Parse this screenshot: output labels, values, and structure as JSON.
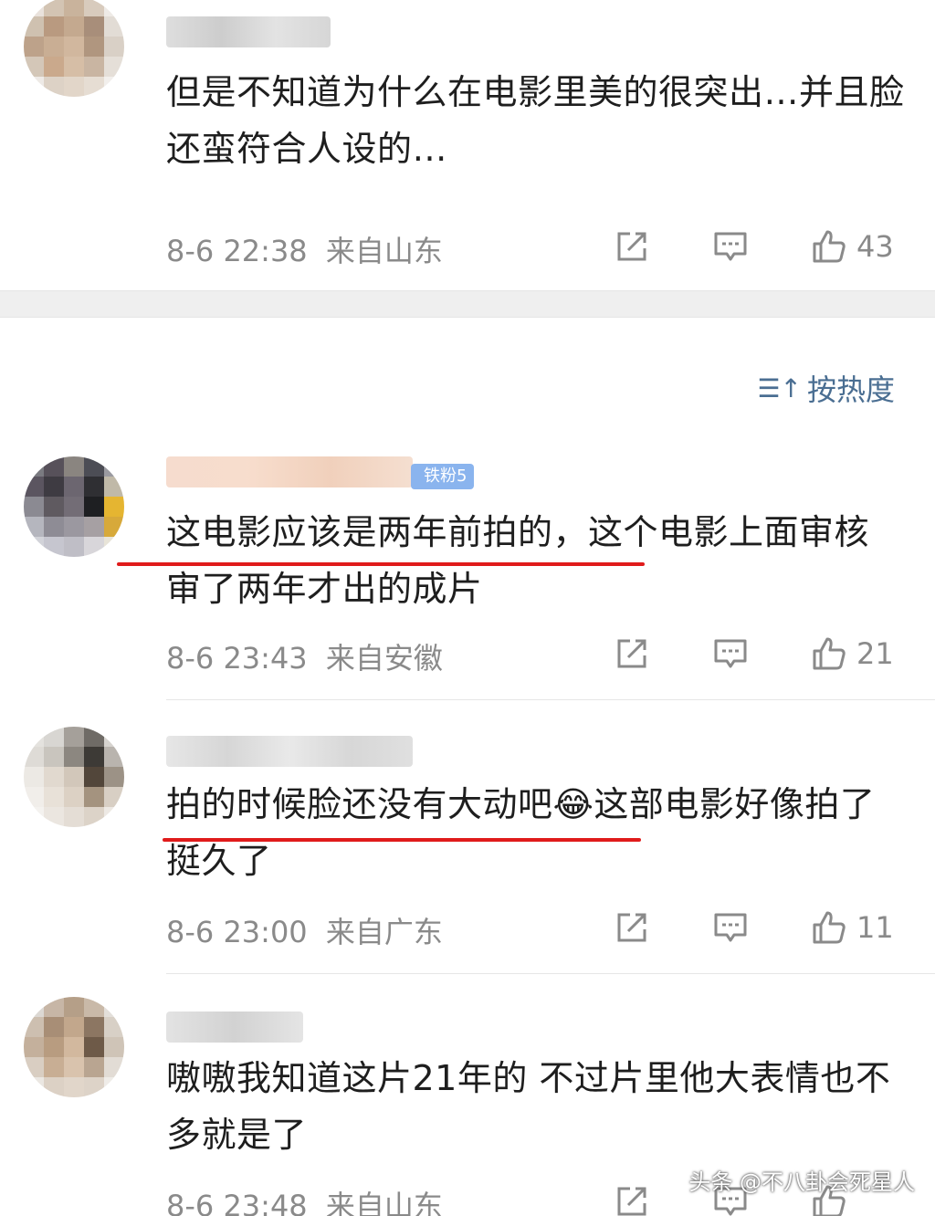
{
  "comments": [
    {
      "text": "但是不知道为什么在电影里美的很突出…并且脸还蛮符合人设的…",
      "time": "8-6 22:38",
      "location": "来自山东",
      "likes": "43"
    },
    {
      "badge": "铁粉5",
      "text": "这电影应该是两年前拍的，这个电影上面审核审了两年才出的成片",
      "time": "8-6 23:43",
      "location": "来自安徽",
      "likes": "21"
    },
    {
      "text": "拍的时候脸还没有大动吧😂这部电影好像拍了挺久了",
      "time": "8-6 23:00",
      "location": "来自广东",
      "likes": "11"
    },
    {
      "text": "嗷嗷我知道这片21年的 不过片里他大表情也不多就是了",
      "time": "8-6 23:48",
      "location": "来自山东"
    }
  ],
  "sort": {
    "icon": "sort-icon",
    "label": "按热度"
  },
  "watermark": "头条 @不八卦会死星人",
  "icons": [
    "share-icon",
    "comment-icon",
    "like-icon"
  ],
  "colors": {
    "link": "#4a6e92",
    "meta": "#8a8a8a",
    "highlight": "#e01b1b"
  }
}
